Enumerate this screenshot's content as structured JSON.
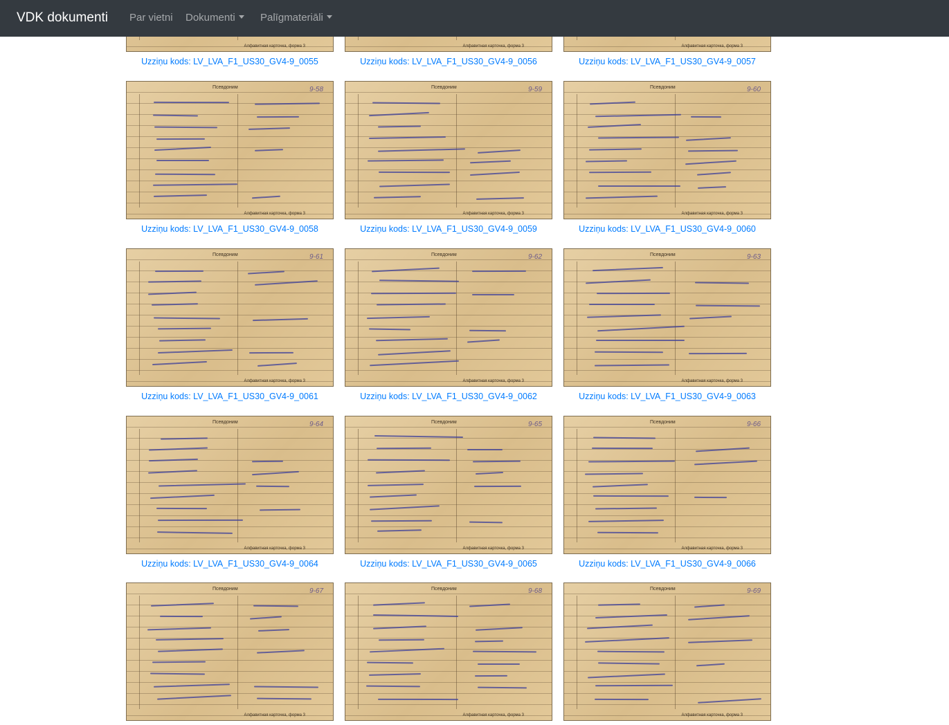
{
  "navbar": {
    "brand": "VDK dokumenti",
    "items": [
      {
        "label": "Par vietni",
        "dropdown": false
      },
      {
        "label": "Dokumenti",
        "dropdown": true
      },
      {
        "label": "Palīgmateriāli",
        "dropdown": true
      }
    ]
  },
  "cards": [
    {
      "code": "Uzziņu kods: LV_LVA_F1_US30_GV4-9_0055",
      "num": ""
    },
    {
      "code": "Uzziņu kods: LV_LVA_F1_US30_GV4-9_0056",
      "num": ""
    },
    {
      "code": "Uzziņu kods: LV_LVA_F1_US30_GV4-9_0057",
      "num": ""
    },
    {
      "code": "Uzziņu kods: LV_LVA_F1_US30_GV4-9_0058",
      "num": "9-58"
    },
    {
      "code": "Uzziņu kods: LV_LVA_F1_US30_GV4-9_0059",
      "num": "9-59"
    },
    {
      "code": "Uzziņu kods: LV_LVA_F1_US30_GV4-9_0060",
      "num": "9-60"
    },
    {
      "code": "Uzziņu kods: LV_LVA_F1_US30_GV4-9_0061",
      "num": "9-61"
    },
    {
      "code": "Uzziņu kods: LV_LVA_F1_US30_GV4-9_0062",
      "num": "9-62"
    },
    {
      "code": "Uzziņu kods: LV_LVA_F1_US30_GV4-9_0063",
      "num": "9-63"
    },
    {
      "code": "Uzziņu kods: LV_LVA_F1_US30_GV4-9_0064",
      "num": "9-64"
    },
    {
      "code": "Uzziņu kods: LV_LVA_F1_US30_GV4-9_0065",
      "num": "9-65"
    },
    {
      "code": "Uzziņu kods: LV_LVA_F1_US30_GV4-9_0066",
      "num": "9-66"
    },
    {
      "code": "",
      "num": "9-67"
    },
    {
      "code": "",
      "num": "9-68"
    },
    {
      "code": "",
      "num": "9-69"
    }
  ],
  "card_print": {
    "header": "Псевдоним",
    "footer": "Алфавитная карточка, форма 3"
  }
}
